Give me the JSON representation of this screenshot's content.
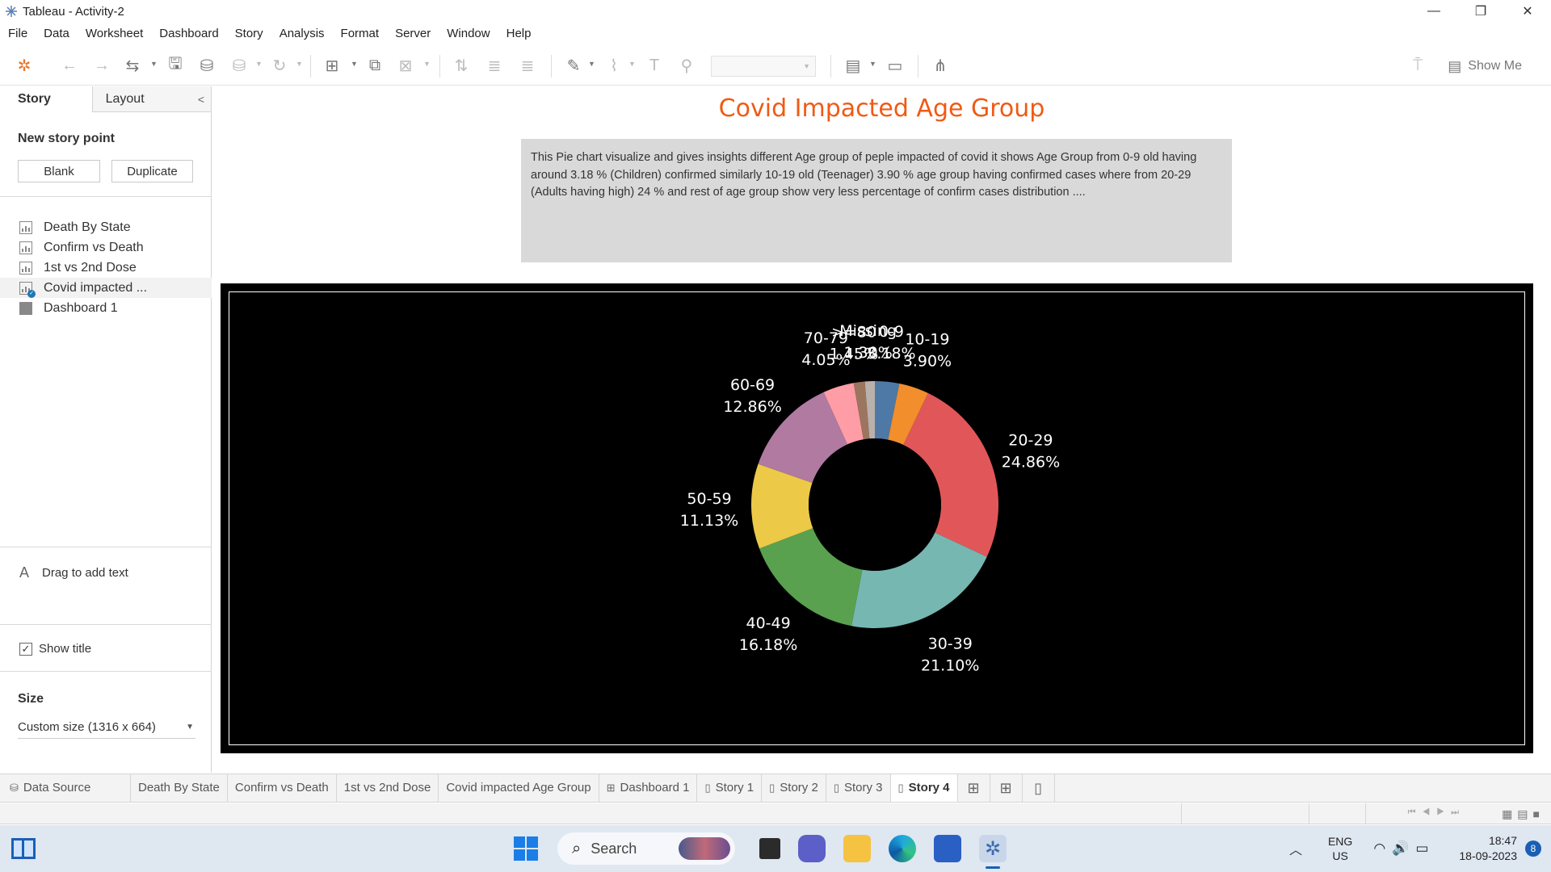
{
  "window": {
    "title": "Tableau - Activity-2",
    "minimize": "—",
    "restore": "❐",
    "close": "✕"
  },
  "menu": [
    "File",
    "Data",
    "Worksheet",
    "Dashboard",
    "Story",
    "Analysis",
    "Format",
    "Server",
    "Window",
    "Help"
  ],
  "toolbar": {
    "show_me_label": "Show Me"
  },
  "left_panel": {
    "tabs": {
      "story": "Story",
      "layout": "Layout"
    },
    "new_story_point_title": "New story point",
    "blank_button": "Blank",
    "duplicate_button": "Duplicate",
    "story_points": [
      {
        "label": "Death By State",
        "type": "sheet",
        "selected": false
      },
      {
        "label": "Confirm vs Death",
        "type": "sheet",
        "selected": false
      },
      {
        "label": "1st vs 2nd Dose",
        "type": "sheet",
        "selected": false
      },
      {
        "label": "Covid impacted ...",
        "type": "sheet",
        "selected": true
      },
      {
        "label": "Dashboard 1",
        "type": "dashboard",
        "selected": false
      }
    ],
    "drag_text": "Drag to add text",
    "show_title_label": "Show title",
    "show_title_checked": true,
    "size_title": "Size",
    "size_value": "Custom size (1316 x 664)"
  },
  "story": {
    "title": "Covid Impacted Age Group",
    "caption": "This Pie chart visualize and gives insights different Age group of peple impacted of covid it shows Age Group from 0-9 old having around 3.18  % (Children) confirmed similarly 10-19 old (Teenager) 3.90 % age group having confirmed cases where from 20-29 (Adults  having  high) 24 % and rest of age group show very less percentage of confirm cases distribution ...."
  },
  "chart_data": {
    "type": "pie",
    "style": "donut",
    "background": "#000000",
    "title": "",
    "categories": [
      "0-9",
      "10-19",
      "20-29",
      "30-39",
      "40-49",
      "50-59",
      "60-69",
      "70-79",
      ">=80",
      "Missing"
    ],
    "values": [
      3.18,
      3.9,
      24.86,
      21.1,
      16.18,
      11.13,
      12.86,
      4.05,
      1.45,
      1.3
    ],
    "labels": [
      "3.18%",
      "3.90%",
      "24.86%",
      "21.10%",
      "16.18%",
      "11.13%",
      "12.86%",
      "4.05%",
      "1.45%",
      "1.30%"
    ],
    "colors": [
      "#4e79a7",
      "#f28e2b",
      "#e15759",
      "#76b7b2",
      "#59a14f",
      "#edc948",
      "#b07aa1",
      "#ff9da7",
      "#9c755f",
      "#bab0ac"
    ]
  },
  "sheet_tabs": [
    {
      "label": "Data Source",
      "icon": "database-icon",
      "active": false
    },
    {
      "label": "Death By State",
      "icon": "",
      "active": false
    },
    {
      "label": "Confirm vs Death",
      "icon": "",
      "active": false
    },
    {
      "label": "1st vs 2nd Dose",
      "icon": "",
      "active": false
    },
    {
      "label": "Covid impacted Age Group",
      "icon": "",
      "active": false
    },
    {
      "label": "Dashboard 1",
      "icon": "dashboard-icon",
      "active": false
    },
    {
      "label": "Story 1",
      "icon": "story-icon",
      "active": false
    },
    {
      "label": "Story 2",
      "icon": "story-icon",
      "active": false
    },
    {
      "label": "Story 3",
      "icon": "story-icon",
      "active": false
    },
    {
      "label": "Story 4",
      "icon": "story-icon",
      "active": true
    }
  ],
  "taskbar": {
    "search_placeholder": "Search",
    "lang_top": "ENG",
    "lang_bottom": "US",
    "time": "18:47",
    "date": "18-09-2023",
    "notification_count": "8"
  }
}
